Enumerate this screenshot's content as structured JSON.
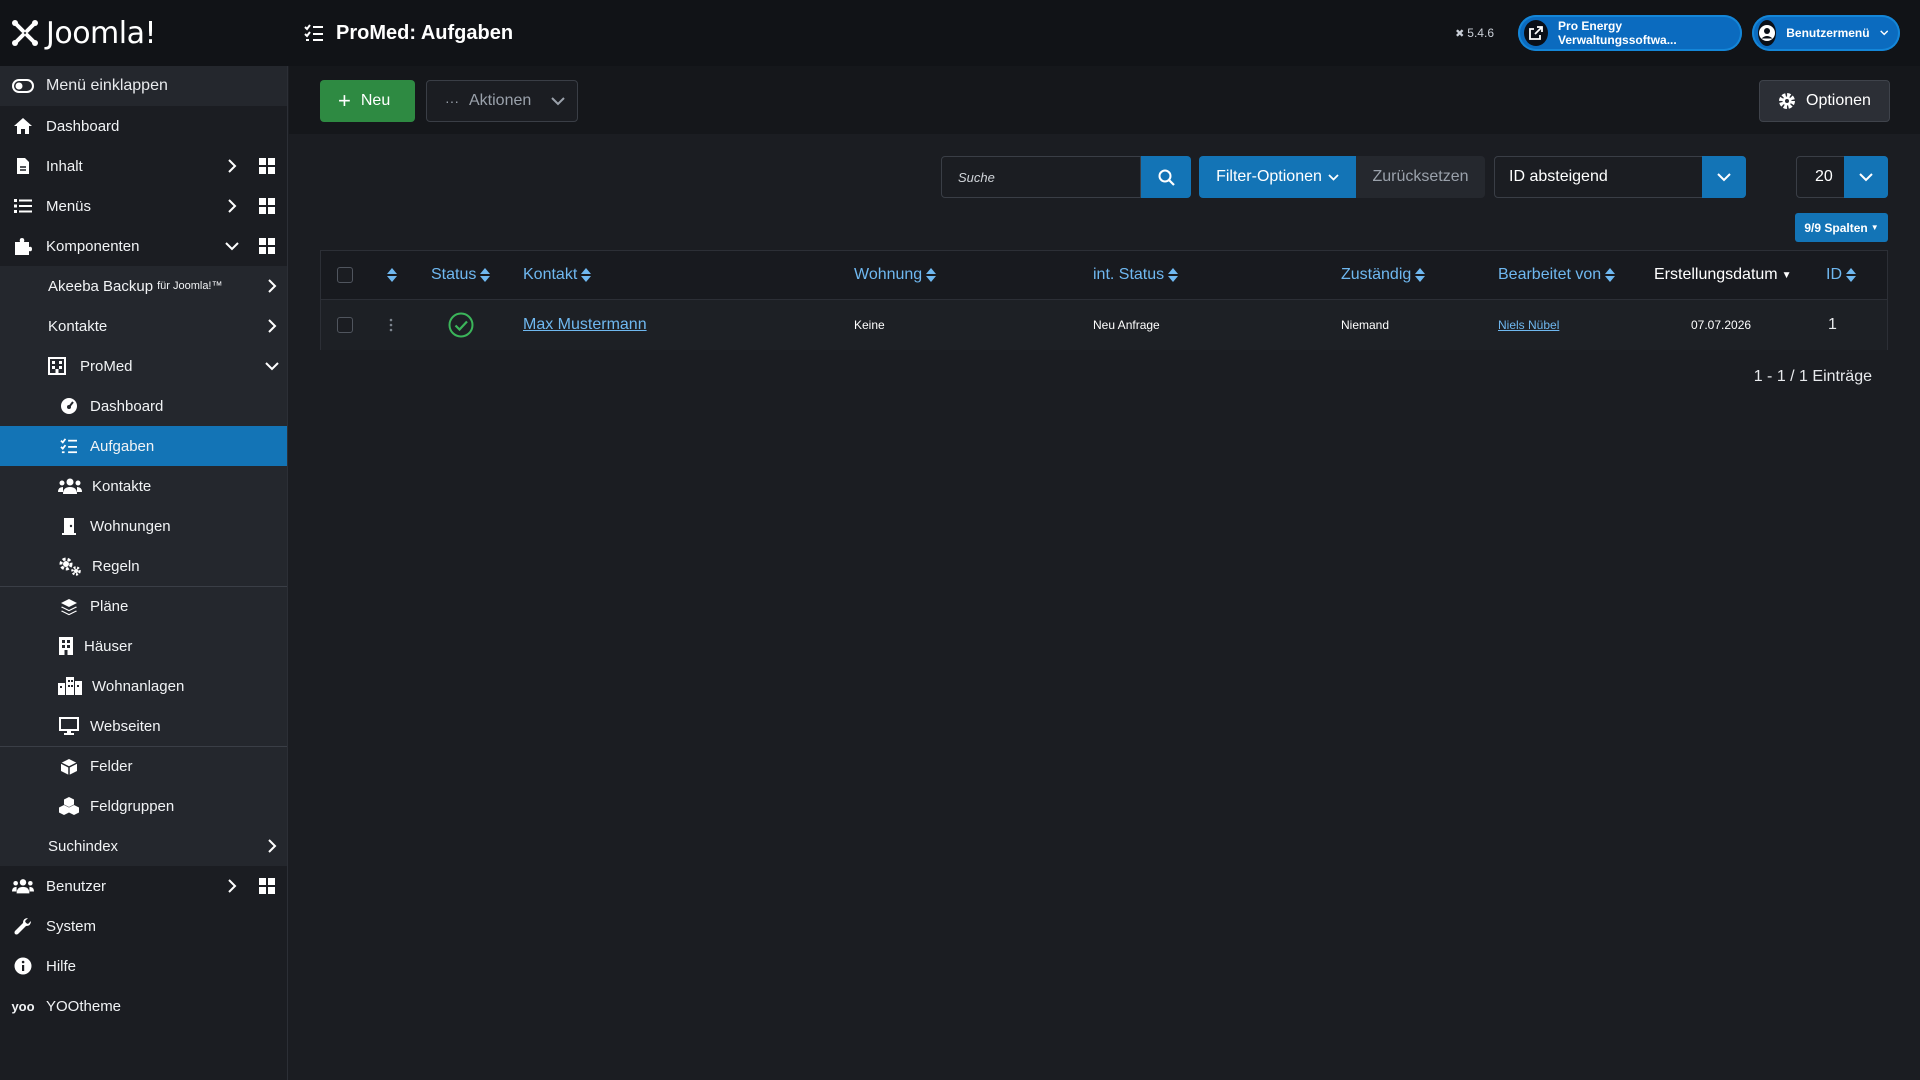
{
  "header": {
    "logo_text": "Joomla!",
    "page_title": "ProMed: Aufgaben",
    "version": "5.4.6",
    "site_button": "Pro Energy Verwaltungssoftwa...",
    "user_menu": "Benutzermenü"
  },
  "sidebar": {
    "collapse_label": "Menü einklappen",
    "items": {
      "dashboard": "Dashboard",
      "inhalt": "Inhalt",
      "menus": "Menüs",
      "komponenten": "Komponenten",
      "akeeba": "Akeeba Backup",
      "akeeba_suffix": "für Joomla!™",
      "kontakte": "Kontakte",
      "promed": "ProMed",
      "pm_dashboard": "Dashboard",
      "pm_aufgaben": "Aufgaben",
      "pm_kontakte": "Kontakte",
      "pm_wohnungen": "Wohnungen",
      "pm_regeln": "Regeln",
      "pm_plaene": "Pläne",
      "pm_haeuser": "Häuser",
      "pm_wohnanlagen": "Wohnanlagen",
      "pm_webseiten": "Webseiten",
      "pm_felder": "Felder",
      "pm_feldgruppen": "Feldgruppen",
      "suchindex": "Suchindex",
      "benutzer": "Benutzer",
      "system": "System",
      "hilfe": "Hilfe",
      "yootheme": "YOOtheme"
    }
  },
  "toolbar": {
    "new_label": "Neu",
    "actions_label": "Aktionen",
    "options_label": "Optionen"
  },
  "filters": {
    "search_placeholder": "Suche",
    "filter_options": "Filter-Optionen",
    "reset": "Zurücksetzen",
    "sort_value": "ID absteigend",
    "limit_value": "20",
    "columns_label": "9/9 Spalten"
  },
  "table": {
    "headers": {
      "status": "Status",
      "kontakt": "Kontakt",
      "wohnung": "Wohnung",
      "int_status": "int. Status",
      "zustaendig": "Zuständig",
      "bearbeitet_von": "Bearbeitet von",
      "erstellungsdatum": "Erstellungsdatum",
      "id": "ID"
    },
    "rows": [
      {
        "kontakt": "Max Mustermann",
        "wohnung": "Keine",
        "int_status": "Neu Anfrage",
        "zustaendig": "Niemand",
        "bearbeitet_von": "Niels Nübel",
        "erstellungsdatum": "07.07.2026",
        "id": "1"
      }
    ],
    "footer": "1 - 1 / 1 Einträge"
  },
  "colors": {
    "accent": "#1374b6",
    "success": "#2e8a42",
    "link": "#6fb8f0",
    "header_bg": "#111317"
  }
}
